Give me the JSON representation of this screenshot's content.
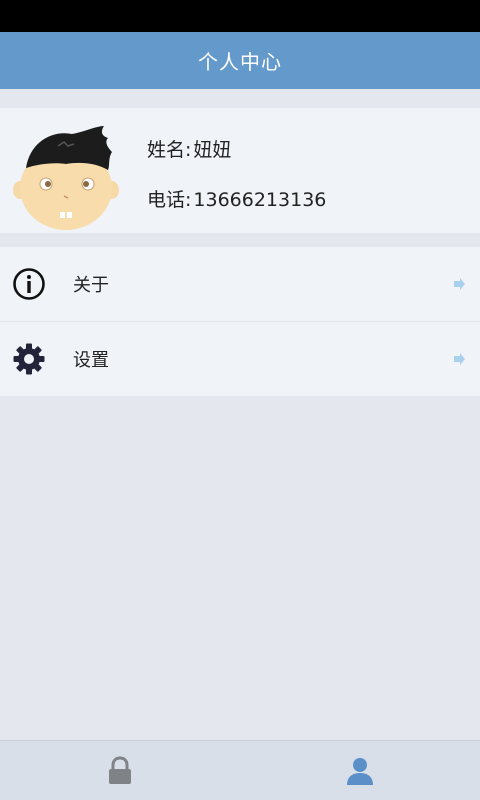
{
  "header": {
    "title": "个人中心"
  },
  "profile": {
    "name_label": "姓名:",
    "name_value": "妞妞",
    "phone_label": "电话:",
    "phone_value": "13666213136"
  },
  "menu": {
    "items": [
      {
        "label": "关于",
        "icon": "info-icon"
      },
      {
        "label": "设置",
        "icon": "gear-icon"
      }
    ]
  },
  "tabs": [
    {
      "icon": "lock-icon",
      "active": false
    },
    {
      "icon": "user-icon",
      "active": true
    }
  ],
  "colors": {
    "header_bg": "#6499cc",
    "page_bg": "#e4e8ee",
    "card_bg": "#f0f3f8",
    "tab_active": "#5b8fc8",
    "tab_inactive": "#7f8287"
  }
}
